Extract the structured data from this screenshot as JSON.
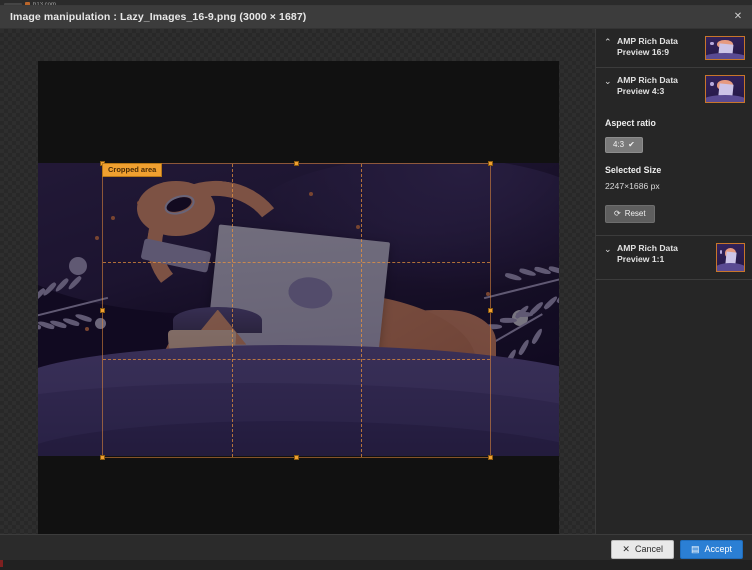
{
  "browser": {
    "tab_title": "b13.com",
    "favicon": "site-favicon"
  },
  "modal": {
    "title": "Image manipulation : Lazy_Images_16-9.png (3000 × 1687)",
    "close_icon": "close-icon"
  },
  "editor": {
    "crop_label": "Cropped area"
  },
  "sidebar": {
    "panels": [
      {
        "chevron": "⌃",
        "chevron_name": "chevron-up-icon",
        "title": "AMP Rich Data Preview 16:9",
        "thumb_name": "preview-thumbnail-16-9",
        "expanded": false
      },
      {
        "chevron": "⌄",
        "chevron_name": "chevron-down-icon",
        "title": "AMP Rich Data Preview 4:3",
        "thumb_name": "preview-thumbnail-4-3",
        "expanded": true
      },
      {
        "chevron": "⌄",
        "chevron_name": "chevron-down-icon",
        "title": "AMP Rich Data Preview 1:1",
        "thumb_name": "preview-thumbnail-1-1",
        "expanded": false
      }
    ],
    "aspect_ratio_label": "Aspect ratio",
    "aspect_ratio_value": "4:3",
    "aspect_ratio_check": "✔",
    "selected_size_label": "Selected Size",
    "selected_size_value": "2247×1686 px",
    "reset_label": "Reset",
    "reset_icon": "refresh-icon",
    "reset_glyph": "⟳"
  },
  "footer": {
    "cancel_label": "Cancel",
    "cancel_glyph": "✕",
    "accept_label": "Accept",
    "accept_glyph": "▤"
  },
  "colors": {
    "accent_orange": "#f0a030",
    "accept_blue": "#2b7fd4",
    "panel_bg": "#262626",
    "header_bg": "#3c3c3c"
  }
}
